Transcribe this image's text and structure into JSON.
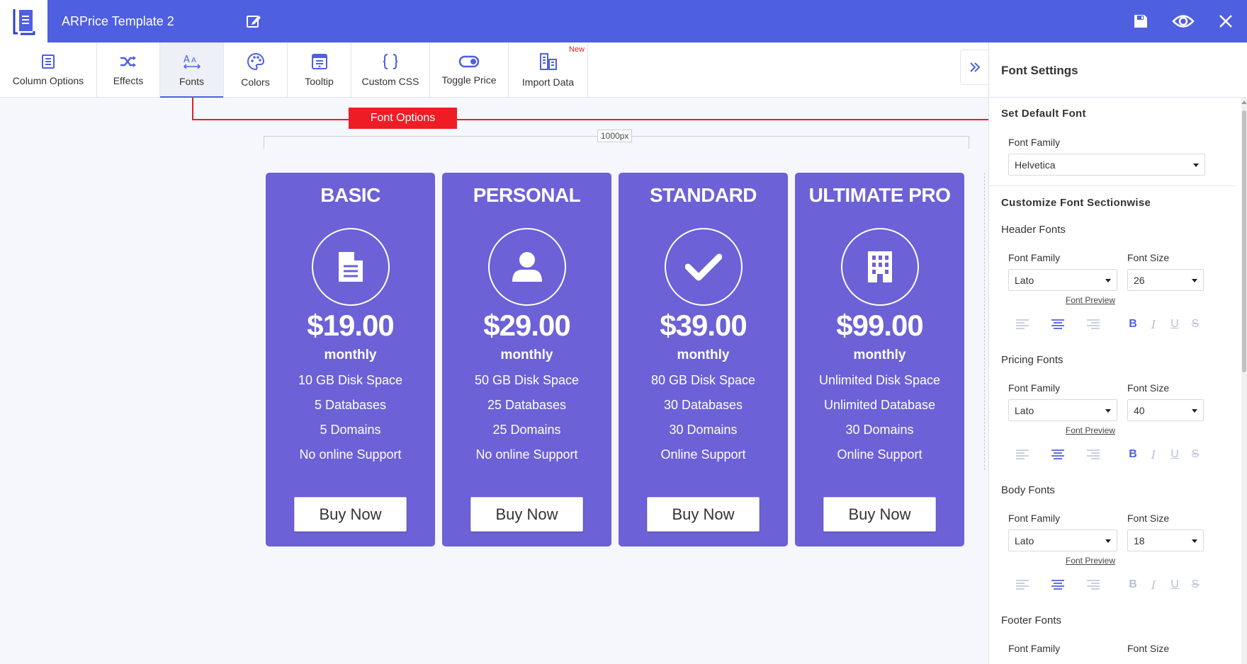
{
  "app": {
    "title": "ARPrice Template 2"
  },
  "toolbar": {
    "items": [
      {
        "label": "Column Options",
        "icon": "column-options-icon"
      },
      {
        "label": "Effects",
        "icon": "shuffle-icon"
      },
      {
        "label": "Fonts",
        "icon": "font-icon",
        "active": true
      },
      {
        "label": "Colors",
        "icon": "palette-icon"
      },
      {
        "label": "Tooltip",
        "icon": "tooltip-icon"
      },
      {
        "label": "Custom CSS",
        "icon": "braces-icon"
      },
      {
        "label": "Toggle Price",
        "icon": "toggle-icon"
      },
      {
        "label": "Import Data",
        "icon": "import-data-icon",
        "badge": "New"
      }
    ]
  },
  "annotation": {
    "label": "Font Options",
    "color": "#ee1c25"
  },
  "canvas": {
    "width_label": "1000px"
  },
  "columns": [
    {
      "title": "BASIC",
      "icon": "document-icon",
      "price": "$19.00",
      "period": "monthly",
      "features": [
        "10 GB Disk Space",
        "5 Databases",
        "5 Domains",
        "No online Support"
      ],
      "button": "Buy Now"
    },
    {
      "title": "PERSONAL",
      "icon": "user-icon",
      "price": "$29.00",
      "period": "monthly",
      "features": [
        "50 GB Disk Space",
        "25 Databases",
        "25 Domains",
        "No online Support"
      ],
      "button": "Buy Now"
    },
    {
      "title": "STANDARD",
      "icon": "checkmark-icon",
      "price": "$39.00",
      "period": "monthly",
      "features": [
        "80 GB Disk Space",
        "30 Databases",
        "30 Domains",
        "Online Support"
      ],
      "button": "Buy Now"
    },
    {
      "title": "ULTIMATE PRO",
      "icon": "building-icon",
      "price": "$99.00",
      "period": "monthly",
      "features": [
        "Unlimited Disk Space",
        "Unlimited Database",
        "30 Domains",
        "Online Support"
      ],
      "button": "Buy Now"
    }
  ],
  "panel": {
    "title": "Font Settings",
    "default_font": {
      "heading": "Set Default Font",
      "family_label": "Font Family",
      "family_value": "Helvetica"
    },
    "sectionwise_heading": "Customize Font Sectionwise",
    "sections": [
      {
        "name": "Header Fonts",
        "family_label": "Font Family",
        "family_value": "Lato",
        "size_label": "Font Size",
        "size_value": "26",
        "preview": "Font Preview",
        "bold_on": true
      },
      {
        "name": "Pricing Fonts",
        "family_label": "Font Family",
        "family_value": "Lato",
        "size_label": "Font Size",
        "size_value": "40",
        "preview": "Font Preview",
        "bold_on": true
      },
      {
        "name": "Body Fonts",
        "family_label": "Font Family",
        "family_value": "Lato",
        "size_label": "Font Size",
        "size_value": "18",
        "preview": "Font Preview",
        "bold_on": false
      },
      {
        "name": "Footer Fonts",
        "family_label": "Font Family",
        "size_label": "Font Size"
      }
    ]
  },
  "colors": {
    "brand": "#4e5fe0",
    "column": "#6c61d6",
    "annotation": "#ee1c25"
  }
}
